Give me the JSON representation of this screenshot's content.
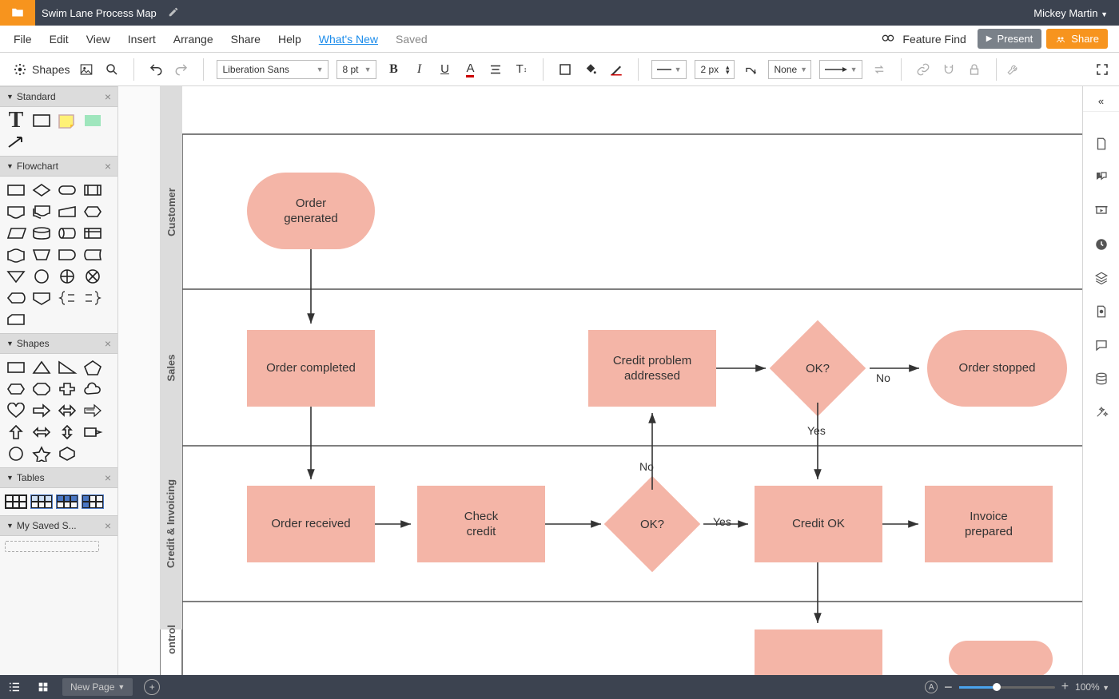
{
  "header": {
    "doc_title": "Swim Lane Process Map",
    "user_name": "Mickey Martin"
  },
  "menu": {
    "items": [
      "File",
      "Edit",
      "View",
      "Insert",
      "Arrange",
      "Share",
      "Help"
    ],
    "whats_new": "What's New",
    "saved": "Saved",
    "feature_find": "Feature Find",
    "present": "Present",
    "share": "Share"
  },
  "toolbar": {
    "shapes": "Shapes",
    "font_family": "Liberation Sans",
    "font_size": "8 pt",
    "line_width": "2 px",
    "line_style": "None"
  },
  "panels": {
    "standard": "Standard",
    "flowchart": "Flowchart",
    "shapes": "Shapes",
    "tables": "Tables",
    "saved": "My Saved S..."
  },
  "lanes": {
    "l1": "Customer",
    "l2": "Sales",
    "l3": "Credit & Invoicing",
    "l4": "ontrol"
  },
  "nodes": {
    "order_generated": "Order\ngenerated",
    "order_completed": "Order completed",
    "credit_problem": "Credit problem\naddressed",
    "ok1": "OK?",
    "order_stopped": "Order stopped",
    "order_received": "Order received",
    "check_credit": "Check\ncredit",
    "ok2": "OK?",
    "credit_ok": "Credit OK",
    "invoice_prepared": "Invoice\nprepared"
  },
  "edge_labels": {
    "no1": "No",
    "yes1": "Yes",
    "no2": "No",
    "yes2": "Yes"
  },
  "status": {
    "new_page": "New Page",
    "zoom": "100%"
  }
}
